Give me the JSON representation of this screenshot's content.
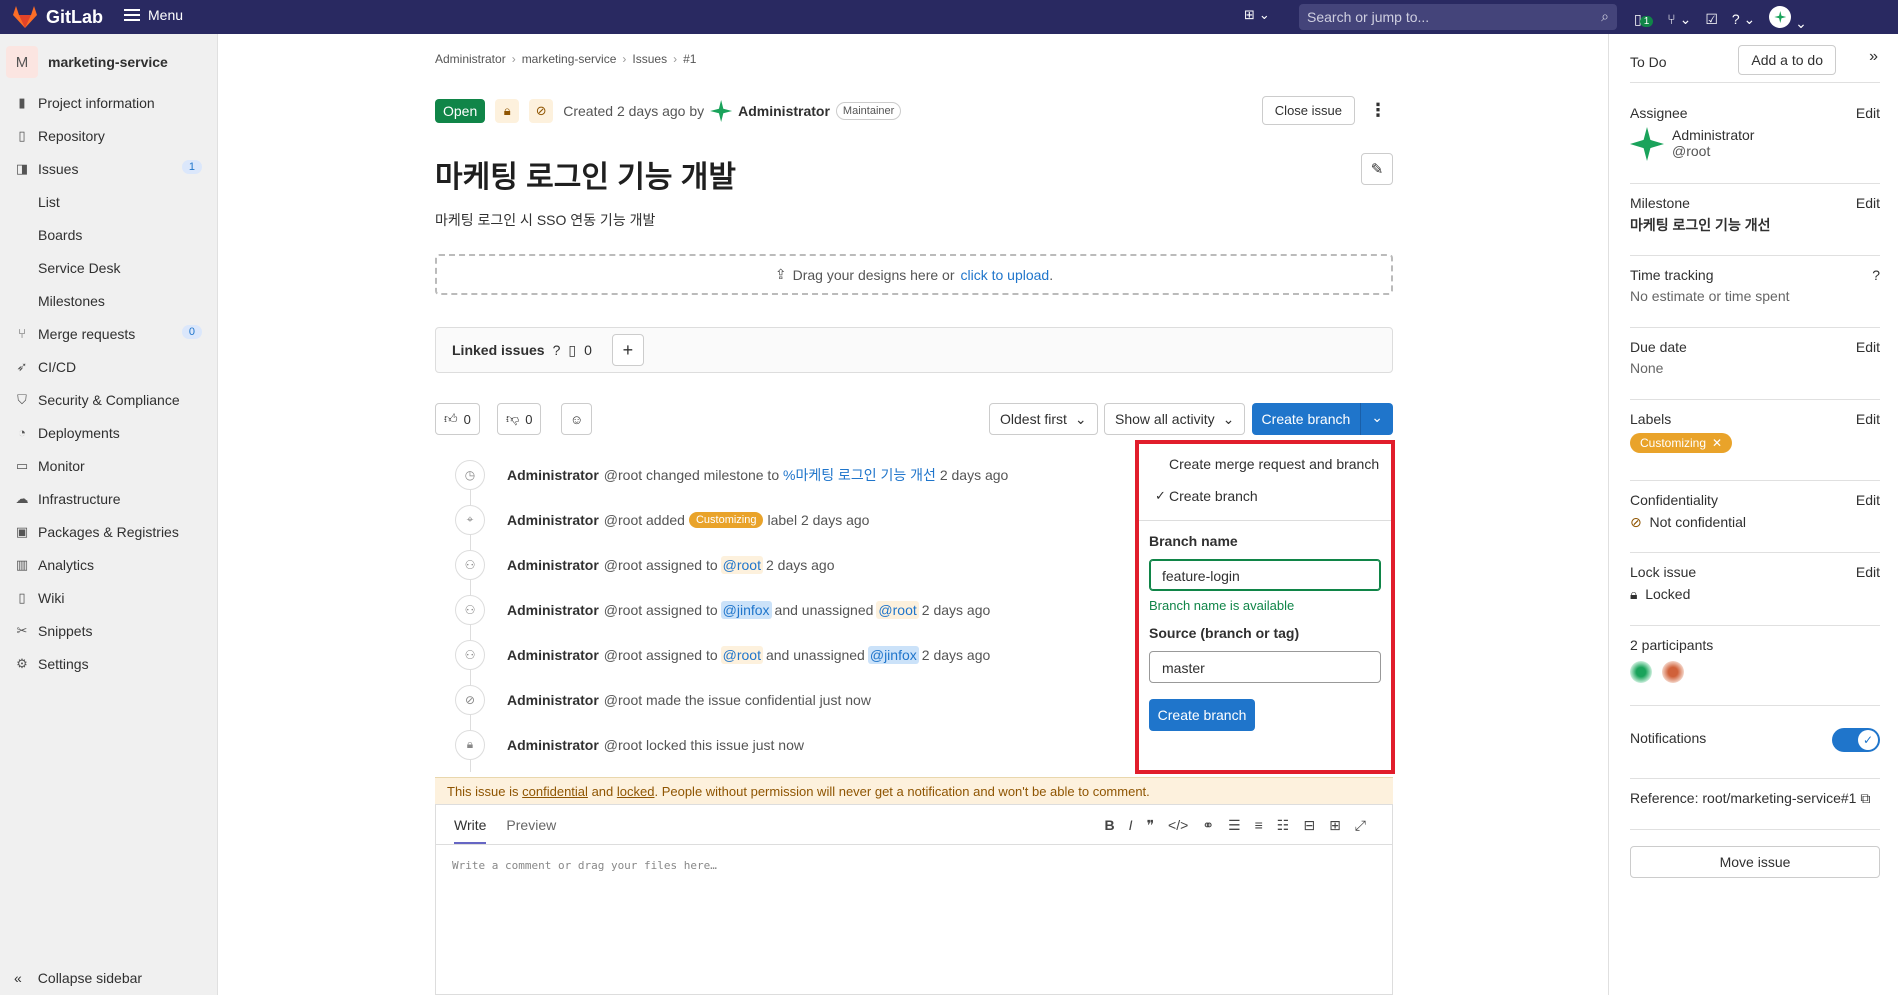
{
  "topbar": {
    "brand": "GitLab",
    "menu": "Menu",
    "search_placeholder": "Search or jump to...",
    "mr_count": "1"
  },
  "sidebar": {
    "project_initial": "M",
    "project_name": "marketing-service",
    "items": [
      {
        "label": "Project information",
        "icon": "info-icon"
      },
      {
        "label": "Repository",
        "icon": "repo-icon"
      },
      {
        "label": "Issues",
        "icon": "issues-icon",
        "count": "1"
      }
    ],
    "issue_sub": [
      "List",
      "Boards",
      "Service Desk",
      "Milestones"
    ],
    "items2": [
      {
        "label": "Merge requests",
        "count": "0"
      },
      {
        "label": "CI/CD"
      },
      {
        "label": "Security & Compliance"
      },
      {
        "label": "Deployments"
      },
      {
        "label": "Monitor"
      },
      {
        "label": "Infrastructure"
      },
      {
        "label": "Packages & Registries"
      },
      {
        "label": "Analytics"
      },
      {
        "label": "Wiki"
      },
      {
        "label": "Snippets"
      },
      {
        "label": "Settings"
      }
    ],
    "collapse": "Collapse sidebar"
  },
  "breadcrumb": [
    "Administrator",
    "marketing-service",
    "Issues",
    "#1"
  ],
  "issue": {
    "status": "Open",
    "created": "Created 2 days ago by",
    "author": "Administrator",
    "role": "Maintainer",
    "close_label": "Close issue",
    "title": "마케팅 로그인 기능 개발",
    "description": "마케팅 로그인 시 SSO 연동 기능 개발",
    "drop_text": "Drag your designs here or",
    "drop_link": "click to upload",
    "drop_end": ".",
    "linked_label": "Linked issues",
    "linked_count": "0",
    "thumbs_up": "0",
    "thumbs_down": "0",
    "sort": "Oldest first",
    "filter": "Show all activity",
    "create_branch": "Create branch"
  },
  "timeline": [
    {
      "pre": "@root changed milestone to",
      "link": "%마케팅 로그인 기능 개선",
      "post": "2 days ago"
    },
    {
      "pre": "@root added",
      "chip": "Customizing",
      "post": "label 2 days ago"
    },
    {
      "pre": "@root assigned to",
      "m1": "@root",
      "post": "2 days ago"
    },
    {
      "pre": "@root assigned to",
      "m1": "@jinfox",
      "mid": "and unassigned",
      "m2": "@root",
      "post": "2 days ago"
    },
    {
      "pre": "@root assigned to",
      "m1": "@root",
      "mid": "and unassigned",
      "m2": "@jinfox",
      "post": "2 days ago"
    },
    {
      "pre": "@root made the issue confidential just now"
    },
    {
      "pre": "@root locked this issue just now"
    }
  ],
  "timeline_author": "Administrator",
  "warning": {
    "a": "This issue is",
    "b": "confidential",
    "c": "and",
    "d": "locked",
    "e": ". People without permission will never get a notification and won't be able to comment."
  },
  "editor": {
    "write": "Write",
    "preview": "Preview",
    "placeholder": "Write a comment or drag your files here…"
  },
  "dropdown": {
    "opt1": "Create merge request and branch",
    "opt2": "Create branch",
    "branch_label": "Branch name",
    "branch_value": "feature-login",
    "available": "Branch name is available",
    "source_label": "Source (branch or tag)",
    "source_value": "master",
    "submit": "Create branch"
  },
  "right": {
    "todo": "To Do",
    "add_todo": "Add a to do",
    "assignee": "Assignee",
    "edit": "Edit",
    "assignee_name": "Administrator",
    "assignee_user": "@root",
    "milestone": "Milestone",
    "milestone_val": "마케팅 로그인 기능 개선",
    "time": "Time tracking",
    "time_val": "No estimate or time spent",
    "due": "Due date",
    "due_val": "None",
    "labels": "Labels",
    "label_chip": "Customizing",
    "conf": "Confidentiality",
    "conf_val": "Not confidential",
    "lock": "Lock issue",
    "lock_val": "Locked",
    "participants": "2 participants",
    "notifications": "Notifications",
    "reference": "Reference: root/marketing-service#1",
    "move": "Move issue"
  },
  "colors": {
    "topbar": "#292961",
    "accent": "#1f75cb",
    "open": "#108548",
    "label": "#e9a32a",
    "highlight": "#e11d2b"
  }
}
